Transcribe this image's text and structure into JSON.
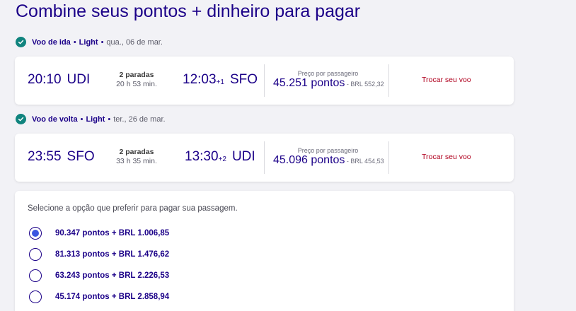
{
  "page": {
    "title": "Combine seus pontos + dinheiro para pagar"
  },
  "outbound": {
    "header": {
      "label": "Voo de ida",
      "fare": "Light",
      "date": "qua., 06 de mar."
    },
    "dep_time": "20:10",
    "dep_iata": "UDI",
    "stops": "2 paradas",
    "duration": "20 h 53 min.",
    "arr_time": "12:03",
    "arr_offset": "+1",
    "arr_iata": "SFO",
    "price_label": "Preço por passageiro",
    "points": "45.251 pontos",
    "brl_prefix": " - ",
    "brl": "BRL 552,32",
    "change_label": "Trocar seu voo"
  },
  "return": {
    "header": {
      "label": "Voo de volta",
      "fare": "Light",
      "date": "ter., 26 de mar."
    },
    "dep_time": "23:55",
    "dep_iata": "SFO",
    "stops": "2 paradas",
    "duration": "33 h 35 min.",
    "arr_time": "13:30",
    "arr_offset": "+2",
    "arr_iata": "UDI",
    "price_label": "Preço por passageiro",
    "points": "45.096 pontos",
    "brl_prefix": " - ",
    "brl": "BRL 454,53",
    "change_label": "Trocar seu voo"
  },
  "payment": {
    "hint": "Selecione a opção que preferir para pagar sua passagem.",
    "options": [
      {
        "label": "90.347 pontos + BRL 1.006,85",
        "selected": true
      },
      {
        "label": "81.313 pontos + BRL 1.476,62",
        "selected": false
      },
      {
        "label": "63.243 pontos + BRL 2.226,53",
        "selected": false
      },
      {
        "label": "45.174 pontos + BRL 2.858,94",
        "selected": false
      }
    ]
  },
  "colors": {
    "brand": "#1b0088",
    "check": "#10847e",
    "change_link": "#b0001e",
    "radio_selected": "#3b56e0",
    "background": "#f2f2f6"
  },
  "icons": {
    "leg_check": "check-circle-icon"
  }
}
